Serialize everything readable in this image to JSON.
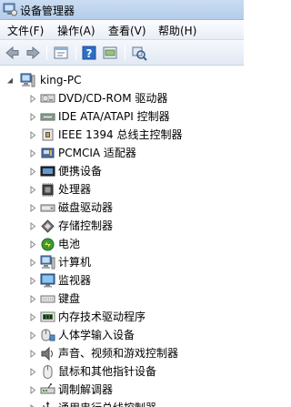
{
  "window": {
    "title": "设备管理器"
  },
  "menu": [
    {
      "label": "文件(F)"
    },
    {
      "label": "操作(A)"
    },
    {
      "label": "查看(V)"
    },
    {
      "label": "帮助(H)"
    }
  ],
  "toolbar": {
    "buttons": [
      {
        "icon": "back-arrow-icon"
      },
      {
        "icon": "forward-arrow-icon"
      },
      {
        "icon": "properties-icon"
      },
      {
        "icon": "help-icon"
      },
      {
        "icon": "update-driver-icon"
      },
      {
        "icon": "scan-hardware-icon"
      }
    ]
  },
  "tree": {
    "root": {
      "label": "king-PC",
      "icon": "computer-icon",
      "expanded": true
    },
    "children": [
      {
        "label": "DVD/CD-ROM 驱动器",
        "icon": "dvd-drive-icon"
      },
      {
        "label": "IDE ATA/ATAPI 控制器",
        "icon": "ide-controller-icon"
      },
      {
        "label": "IEEE 1394 总线主控制器",
        "icon": "firewire-icon"
      },
      {
        "label": "PCMCIA 适配器",
        "icon": "pcmcia-icon"
      },
      {
        "label": "便携设备",
        "icon": "portable-device-icon"
      },
      {
        "label": "处理器",
        "icon": "processor-icon"
      },
      {
        "label": "磁盘驱动器",
        "icon": "disk-drive-icon"
      },
      {
        "label": "存储控制器",
        "icon": "storage-controller-icon"
      },
      {
        "label": "电池",
        "icon": "battery-icon"
      },
      {
        "label": "计算机",
        "icon": "computer-icon"
      },
      {
        "label": "监视器",
        "icon": "monitor-icon"
      },
      {
        "label": "键盘",
        "icon": "keyboard-icon"
      },
      {
        "label": "内存技术驱动程序",
        "icon": "memory-technology-icon"
      },
      {
        "label": "人体学输入设备",
        "icon": "hid-icon"
      },
      {
        "label": "声音、视频和游戏控制器",
        "icon": "sound-icon"
      },
      {
        "label": "鼠标和其他指针设备",
        "icon": "mouse-icon"
      },
      {
        "label": "调制解调器",
        "icon": "modem-icon"
      },
      {
        "label": "通用串行总线控制器",
        "icon": "usb-icon"
      }
    ]
  }
}
